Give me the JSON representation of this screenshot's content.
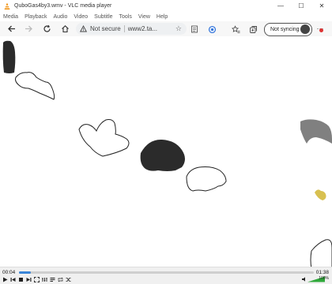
{
  "window": {
    "title": "QuboGas4by3.wmv - VLC media player"
  },
  "menu": [
    "Media",
    "Playback",
    "Audio",
    "Video",
    "Subtitle",
    "Tools",
    "View",
    "Help"
  ],
  "browser": {
    "security_label": "Not secure",
    "url": "www2.ta...",
    "sync_label": "Not syncing"
  },
  "player": {
    "time_current": "00:04",
    "time_total": "01:38",
    "progress": 0.04,
    "volume_label": "100%"
  },
  "colors": {
    "accent": "#3a86d8",
    "shape_fill": "#2b2b2b",
    "shape_gray": "#808080",
    "shape_yellow": "#d8c050"
  }
}
